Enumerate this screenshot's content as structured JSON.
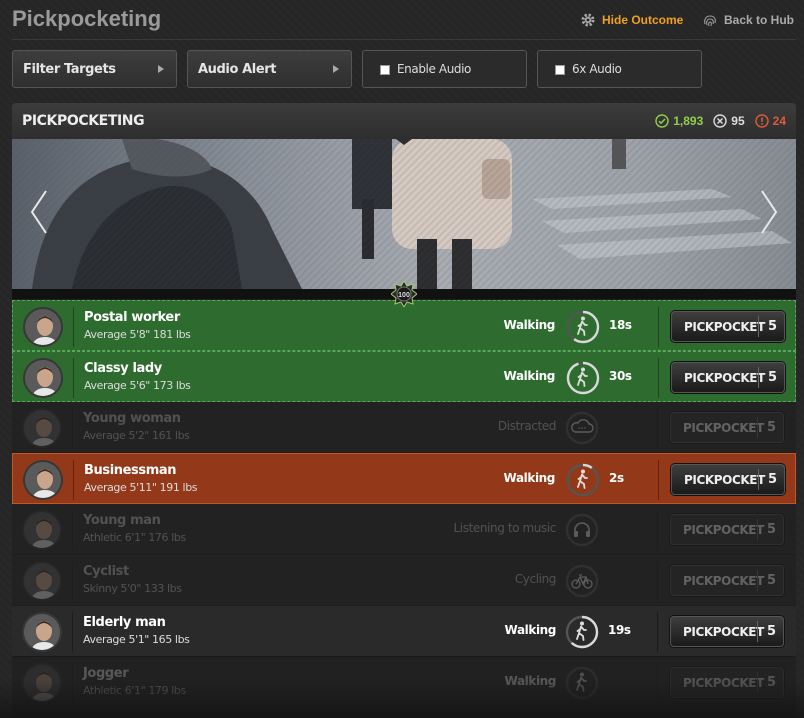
{
  "header": {
    "title": "Pickpocketing",
    "hide_outcome": "Hide Outcome",
    "back_to_hub": "Back to Hub"
  },
  "controls": {
    "filter_targets": "Filter Targets",
    "audio_alert": "Audio Alert",
    "enable_audio": "Enable Audio",
    "six_x_audio": "6x Audio"
  },
  "panel": {
    "title": "PICKPOCKETING",
    "stats": {
      "success": "1,893",
      "fail": "95",
      "alert": "24"
    },
    "badge_text": "100"
  },
  "targets": [
    {
      "name": "Postal worker",
      "desc": "Average 5'8\" 181 lbs",
      "status": "Walking",
      "time": "18s",
      "button": "PICKPOCKET",
      "cost": "5",
      "state": "green",
      "icon": "walking-icon"
    },
    {
      "name": "Classy lady",
      "desc": "Average 5'6\" 173 lbs",
      "status": "Walking",
      "time": "30s",
      "button": "PICKPOCKET",
      "cost": "5",
      "state": "green",
      "icon": "walking-icon"
    },
    {
      "name": "Young woman",
      "desc": "Average 5'2\" 161 lbs",
      "status": "Distracted",
      "time": "",
      "button": "PICKPOCKET",
      "cost": "5",
      "state": "dim",
      "icon": "cloud-icon"
    },
    {
      "name": "Businessman",
      "desc": "Average 5'11\" 191 lbs",
      "status": "Walking",
      "time": "2s",
      "button": "PICKPOCKET",
      "cost": "5",
      "state": "orange",
      "icon": "walking-icon"
    },
    {
      "name": "Young man",
      "desc": "Athletic 6'1\" 176 lbs",
      "status": "Listening to music",
      "time": "",
      "button": "PICKPOCKET",
      "cost": "5",
      "state": "dim",
      "icon": "headphones-icon"
    },
    {
      "name": "Cyclist",
      "desc": "Skinny 5'0\" 133 lbs",
      "status": "Cycling",
      "time": "",
      "button": "PICKPOCKET",
      "cost": "5",
      "state": "dim",
      "icon": "bicycle-icon"
    },
    {
      "name": "Elderly man",
      "desc": "Average 5'1\" 165 lbs",
      "status": "Walking",
      "time": "19s",
      "button": "PICKPOCKET",
      "cost": "5",
      "state": "normal",
      "icon": "walking-icon"
    },
    {
      "name": "Jogger",
      "desc": "Athletic 6'1\" 179 lbs",
      "status": "Walking",
      "time": "",
      "button": "PICKPOCKET",
      "cost": "5",
      "state": "fade",
      "icon": "walking-icon"
    }
  ],
  "colors": {
    "accent": "#f0a020",
    "success_row": "#2e6b2f",
    "danger_row": "#93391a",
    "stat_success": "#8ed04a",
    "stat_alert": "#e05a3a"
  }
}
